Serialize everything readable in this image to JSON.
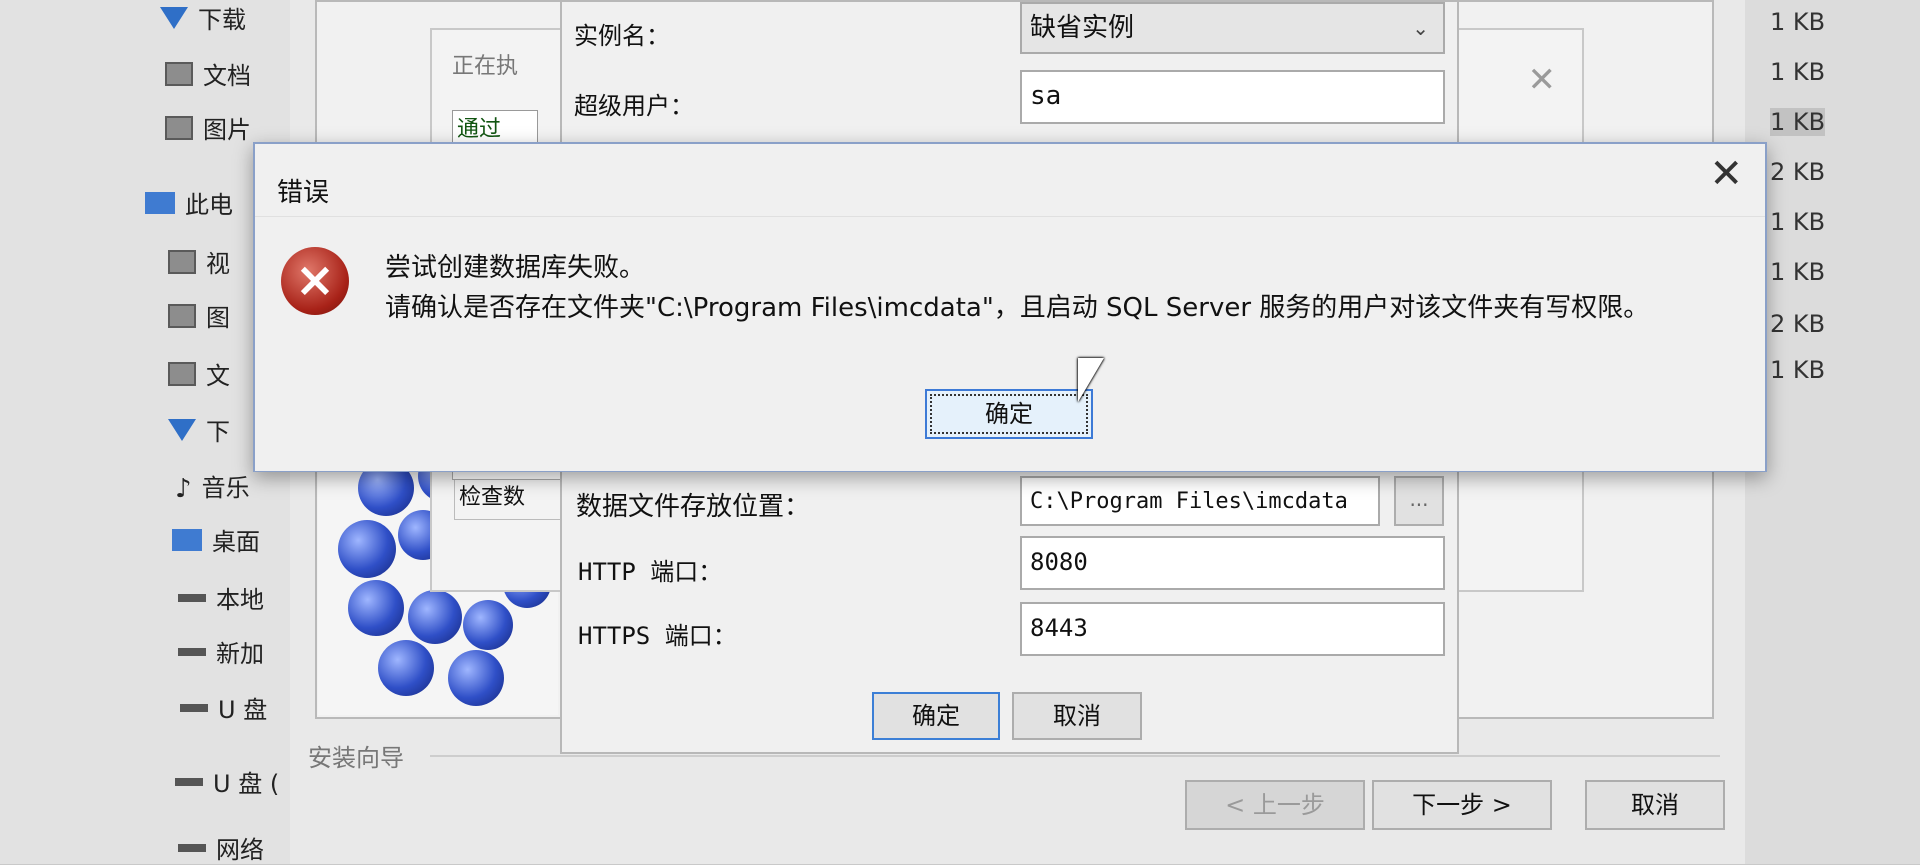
{
  "explorer": {
    "nav_items": [
      {
        "label": "下载",
        "icon": "download-icon"
      },
      {
        "label": "文档",
        "icon": "document-icon"
      },
      {
        "label": "图片",
        "icon": "picture-icon"
      },
      {
        "label": "此电",
        "icon": "computer-icon"
      },
      {
        "label": "视",
        "icon": "video-icon"
      },
      {
        "label": "图",
        "icon": "picture-icon"
      },
      {
        "label": "文",
        "icon": "document-icon"
      },
      {
        "label": "下",
        "icon": "download-icon"
      },
      {
        "label": "音乐",
        "icon": "music-icon"
      },
      {
        "label": "桌面",
        "icon": "desktop-icon"
      },
      {
        "label": "本地",
        "icon": "drive-icon"
      },
      {
        "label": "新加",
        "icon": "drive-icon"
      },
      {
        "label": "U 盘",
        "icon": "usb-drive-icon"
      },
      {
        "label": "U 盘 (",
        "icon": "usb-drive-icon"
      },
      {
        "label": "网络",
        "icon": "network-icon"
      }
    ],
    "file_sizes": [
      "1 KB",
      "1 KB",
      "1 KB",
      "2 KB",
      "1 KB",
      "1 KB",
      "2 KB",
      "1 KB"
    ]
  },
  "progress_dialog": {
    "status_label": "正在执",
    "pass_text": "通过",
    "check_text": "检查数"
  },
  "config": {
    "instance_label": "实例名：",
    "instance_value": "缺省实例",
    "superuser_label": "超级用户：",
    "superuser_value": "sa",
    "datafile_label": "数据文件存放位置：",
    "datafile_value": "C:\\Program Files\\imcdata",
    "browse_label": "...",
    "http_label": "HTTP 端口：",
    "http_value": "8080",
    "https_label": "HTTPS 端口：",
    "https_value": "8443",
    "ok_label": "确定",
    "cancel_label": "取消"
  },
  "wizard": {
    "group_label": "安装向导",
    "prev_label": "< 上一步",
    "next_label": "下一步 >",
    "cancel_label": "取消"
  },
  "error_dialog": {
    "title": "错误",
    "close_glyph": "✕",
    "line1": "尝试创建数据库失败。",
    "line2": "请确认是否存在文件夹\"C:\\Program Files\\imcdata\"，且启动 SQL Server 服务的用户对该文件夹有写权限。",
    "ok_label": "确定"
  }
}
